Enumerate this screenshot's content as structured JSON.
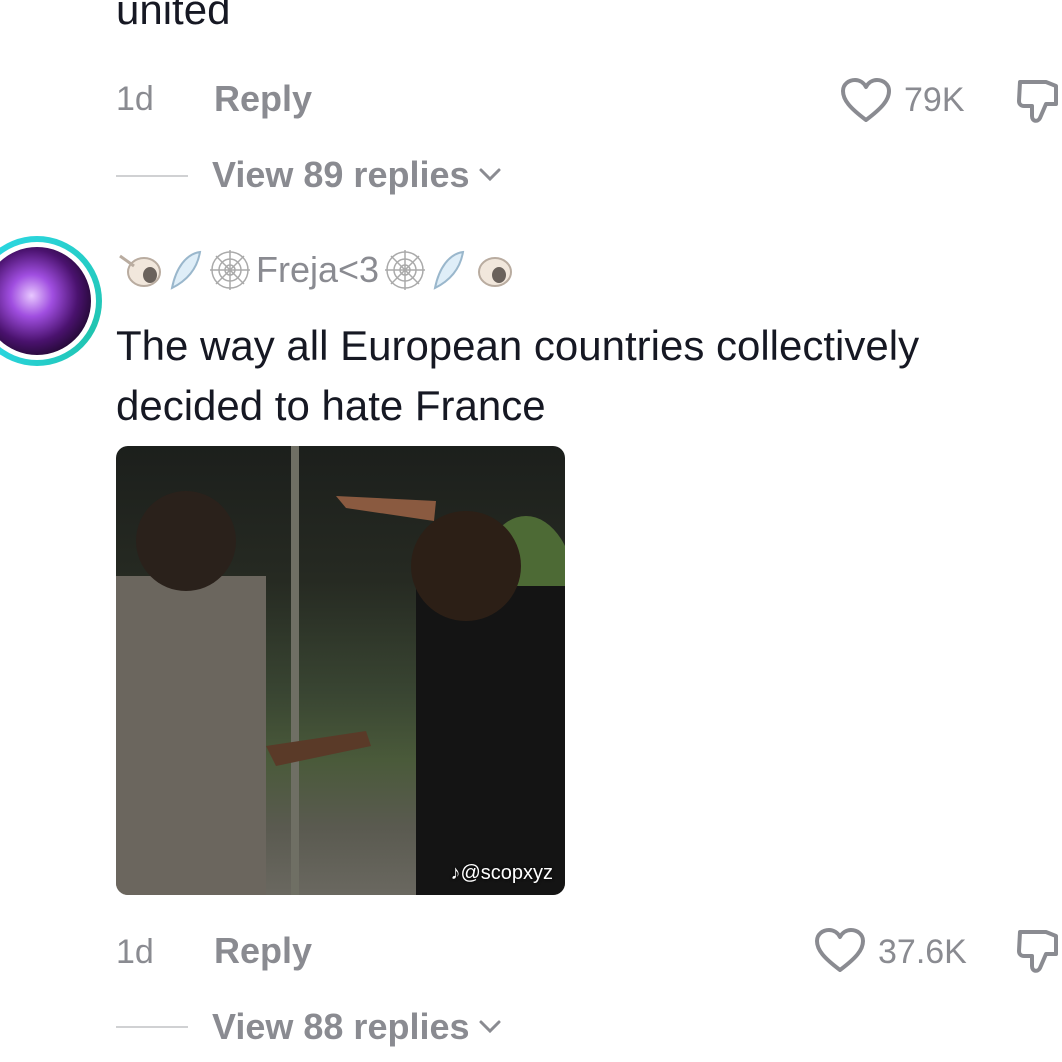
{
  "previous_comment": {
    "text_tail": "united",
    "time": "1d",
    "reply_label": "Reply",
    "like_count": "79K",
    "view_replies_label": "View 89 replies"
  },
  "comment": {
    "username": "Freja<3",
    "text": "The way all European countries collectively decided to hate France",
    "media_watermark": "@scopxyz",
    "time": "1d",
    "reply_label": "Reply",
    "like_count": "37.6K",
    "view_replies_label": "View 88 replies"
  },
  "icons": {
    "like": "heart-outline-icon",
    "dislike": "thumbs-down-icon",
    "expand": "chevron-down-icon",
    "username_decor": [
      "shell-icon",
      "wing-icon",
      "web-icon"
    ]
  },
  "colors": {
    "muted": "#8a8b91",
    "text": "#161823",
    "avatar_ring": "#2ad4d9"
  }
}
